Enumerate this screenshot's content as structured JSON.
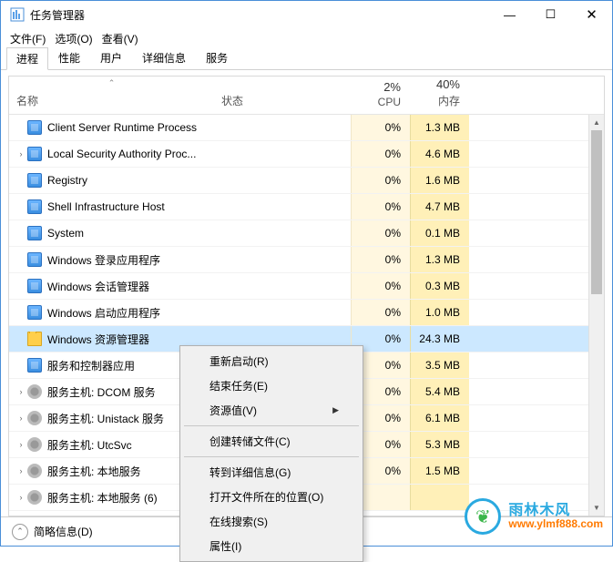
{
  "window": {
    "title": "任务管理器",
    "controls": {
      "min": "—",
      "max": "☐",
      "close": "✕"
    }
  },
  "menu": {
    "file": "文件(F)",
    "options": "选项(O)",
    "view": "查看(V)"
  },
  "tabs": {
    "processes": "进程",
    "performance": "性能",
    "users": "用户",
    "details": "详细信息",
    "services": "服务"
  },
  "columns": {
    "name": "名称",
    "status": "状态",
    "cpu_pct": "2%",
    "cpu_label": "CPU",
    "mem_pct": "40%",
    "mem_label": "内存"
  },
  "processes": [
    {
      "name": "Client Server Runtime Process",
      "cpu": "0%",
      "mem": "1.3 MB",
      "expandable": false,
      "icon": "app",
      "selected": false
    },
    {
      "name": "Local Security Authority Proc...",
      "cpu": "0%",
      "mem": "4.6 MB",
      "expandable": true,
      "icon": "app",
      "selected": false
    },
    {
      "name": "Registry",
      "cpu": "0%",
      "mem": "1.6 MB",
      "expandable": false,
      "icon": "app",
      "selected": false
    },
    {
      "name": "Shell Infrastructure Host",
      "cpu": "0%",
      "mem": "4.7 MB",
      "expandable": false,
      "icon": "app",
      "selected": false
    },
    {
      "name": "System",
      "cpu": "0%",
      "mem": "0.1 MB",
      "expandable": false,
      "icon": "app",
      "selected": false
    },
    {
      "name": "Windows 登录应用程序",
      "cpu": "0%",
      "mem": "1.3 MB",
      "expandable": false,
      "icon": "app",
      "selected": false
    },
    {
      "name": "Windows 会话管理器",
      "cpu": "0%",
      "mem": "0.3 MB",
      "expandable": false,
      "icon": "app",
      "selected": false
    },
    {
      "name": "Windows 启动应用程序",
      "cpu": "0%",
      "mem": "1.0 MB",
      "expandable": false,
      "icon": "app",
      "selected": false
    },
    {
      "name": "Windows 资源管理器",
      "cpu": "0%",
      "mem": "24.3 MB",
      "expandable": false,
      "icon": "folder",
      "selected": true
    },
    {
      "name": "服务和控制器应用",
      "cpu": "0%",
      "mem": "3.5 MB",
      "expandable": false,
      "icon": "app",
      "selected": false
    },
    {
      "name": "服务主机: DCOM 服务",
      "cpu": "0%",
      "mem": "5.4 MB",
      "expandable": true,
      "icon": "gear",
      "selected": false
    },
    {
      "name": "服务主机: Unistack 服务",
      "cpu": "0%",
      "mem": "6.1 MB",
      "expandable": true,
      "icon": "gear",
      "selected": false
    },
    {
      "name": "服务主机: UtcSvc",
      "cpu": "0%",
      "mem": "5.3 MB",
      "expandable": true,
      "icon": "gear",
      "selected": false
    },
    {
      "name": "服务主机: 本地服务",
      "cpu": "0%",
      "mem": "1.5 MB",
      "expandable": true,
      "icon": "gear",
      "selected": false
    },
    {
      "name": "服务主机: 本地服务 (6)",
      "cpu": "",
      "mem": "",
      "expandable": true,
      "icon": "gear",
      "selected": false
    }
  ],
  "context_menu": {
    "restart": "重新启动(R)",
    "end_task": "结束任务(E)",
    "resource_values": "资源值(V)",
    "create_dump": "创建转储文件(C)",
    "go_details": "转到详细信息(G)",
    "open_location": "打开文件所在的位置(O)",
    "search_online": "在线搜索(S)",
    "properties": "属性(I)"
  },
  "statusbar": {
    "fewer": "简略信息(D)"
  },
  "watermark": {
    "brand": "雨林木风",
    "url": "www.ylmf888.com"
  }
}
